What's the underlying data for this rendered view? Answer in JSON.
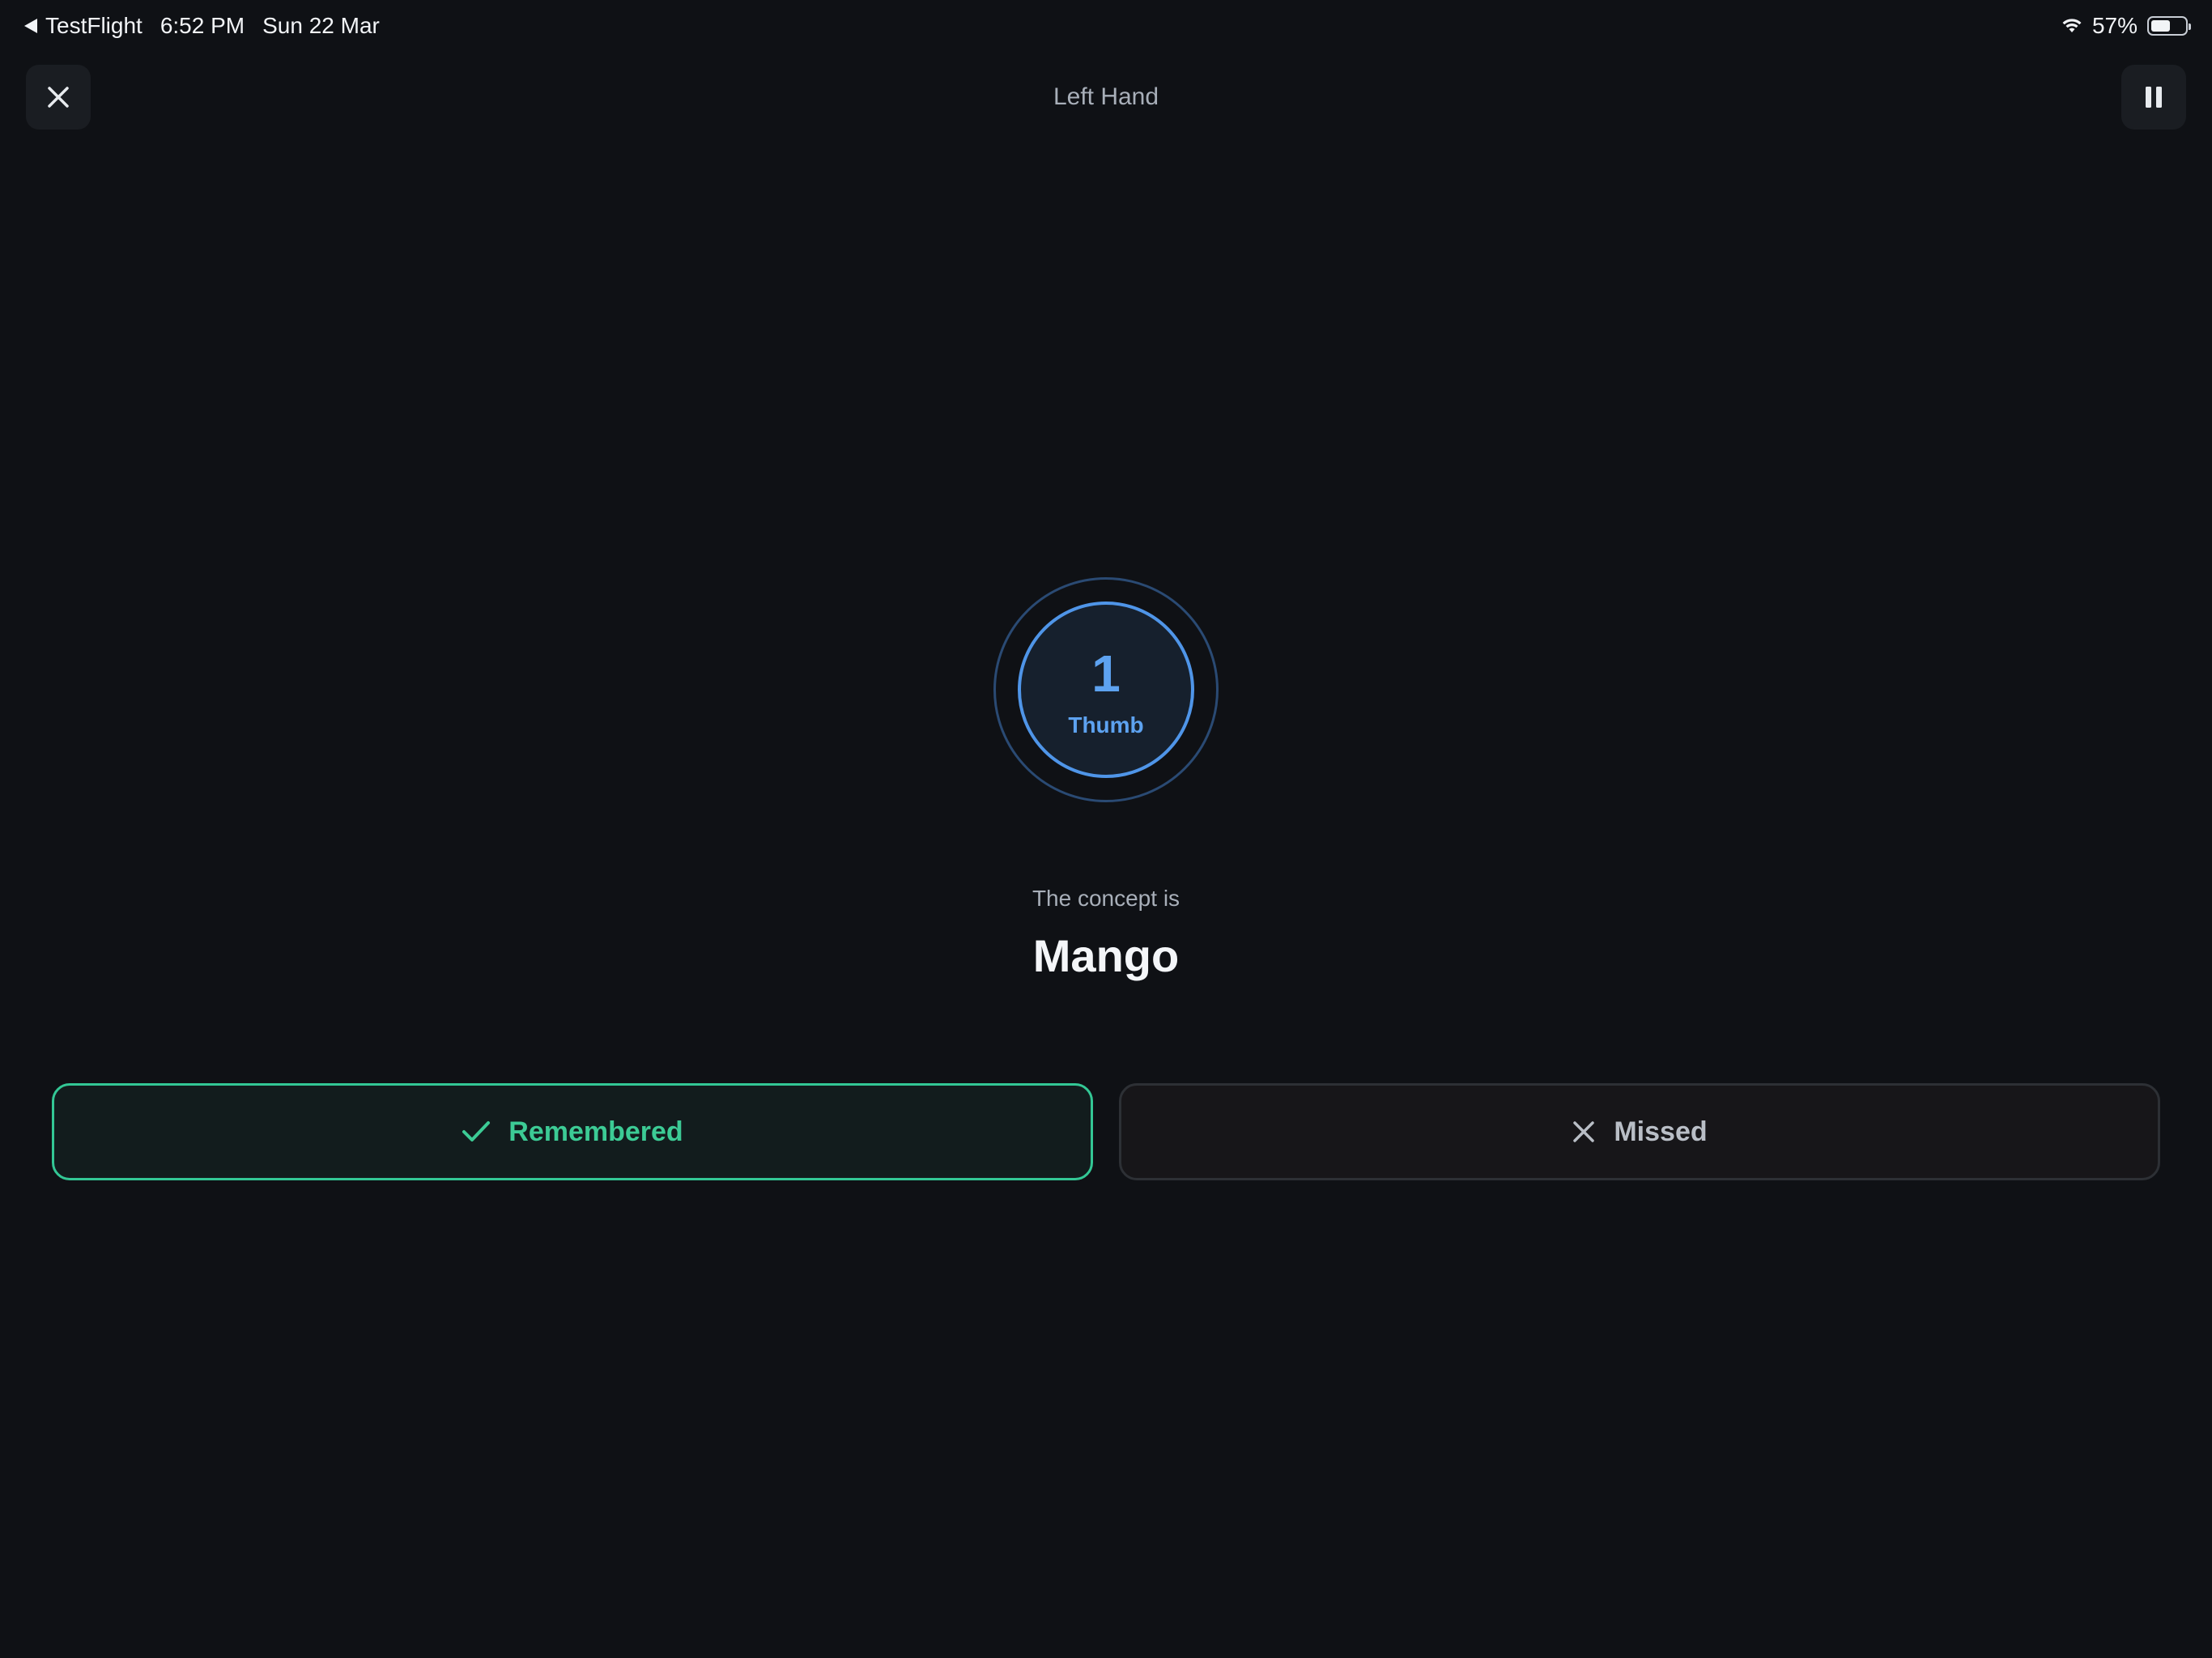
{
  "status_bar": {
    "back_app": "TestFlight",
    "time": "6:52 PM",
    "date": "Sun 22 Mar",
    "battery_percent": "57%",
    "battery_level": 0.57
  },
  "nav": {
    "title": "Left Hand",
    "close_icon": "close-icon",
    "pause_icon": "pause-icon"
  },
  "finger": {
    "number": "1",
    "name": "Thumb"
  },
  "concept": {
    "label": "The concept is",
    "word": "Mango"
  },
  "actions": {
    "remembered_label": "Remembered",
    "remembered_icon": "check-icon",
    "missed_label": "Missed",
    "missed_icon": "x-icon"
  },
  "colors": {
    "background": "#0f1115",
    "accent_blue": "#5da2f0",
    "success_green": "#3ccb95"
  }
}
